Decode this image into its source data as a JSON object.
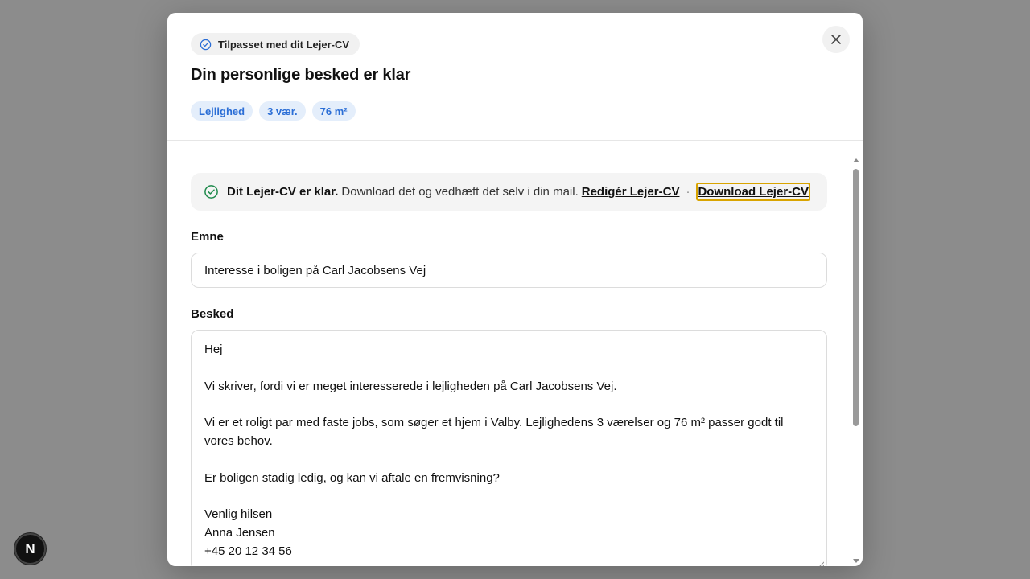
{
  "modal": {
    "context_chip": "Tilpasset med dit Lejer-CV",
    "title": "Din personlige besked er klar",
    "tags": [
      "Lejlighed",
      "3 vær.",
      "76 m²"
    ],
    "close_icon": "close-icon"
  },
  "notice": {
    "icon": "check-circle-icon",
    "strong_text": "Dit Lejer-CV er klar.",
    "text": "Download det og vedhæft det selv i din mail.",
    "edit_link": "Redigér Lejer-CV",
    "separator": "·",
    "download_link": "Download Lejer-CV"
  },
  "subject": {
    "label": "Emne",
    "value": "Interesse i boligen på Carl Jacobsens Vej"
  },
  "message": {
    "label": "Besked",
    "lines": [
      "Hej",
      "",
      "Vi skriver, fordi vi er meget interesserede i lejligheden på Carl Jacobsens Vej.",
      "",
      "Vi er et roligt par med faste jobs, som søger et hjem i Valby. Lejlighedens 3 værelser og 76 m² passer godt til vores behov.",
      "",
      "Er boligen stadig ledig, og kan vi aftale en fremvisning?",
      "",
      "Venlig hilsen",
      "Anna Jensen",
      "+45 20 12 34 56"
    ]
  },
  "colors": {
    "accent_blue": "#2b6ed6",
    "tag_bg": "#e4eefb",
    "success_green": "#1f8a4c",
    "focus_outline": "#d9a400"
  },
  "dev_badge": {
    "label": "N"
  }
}
